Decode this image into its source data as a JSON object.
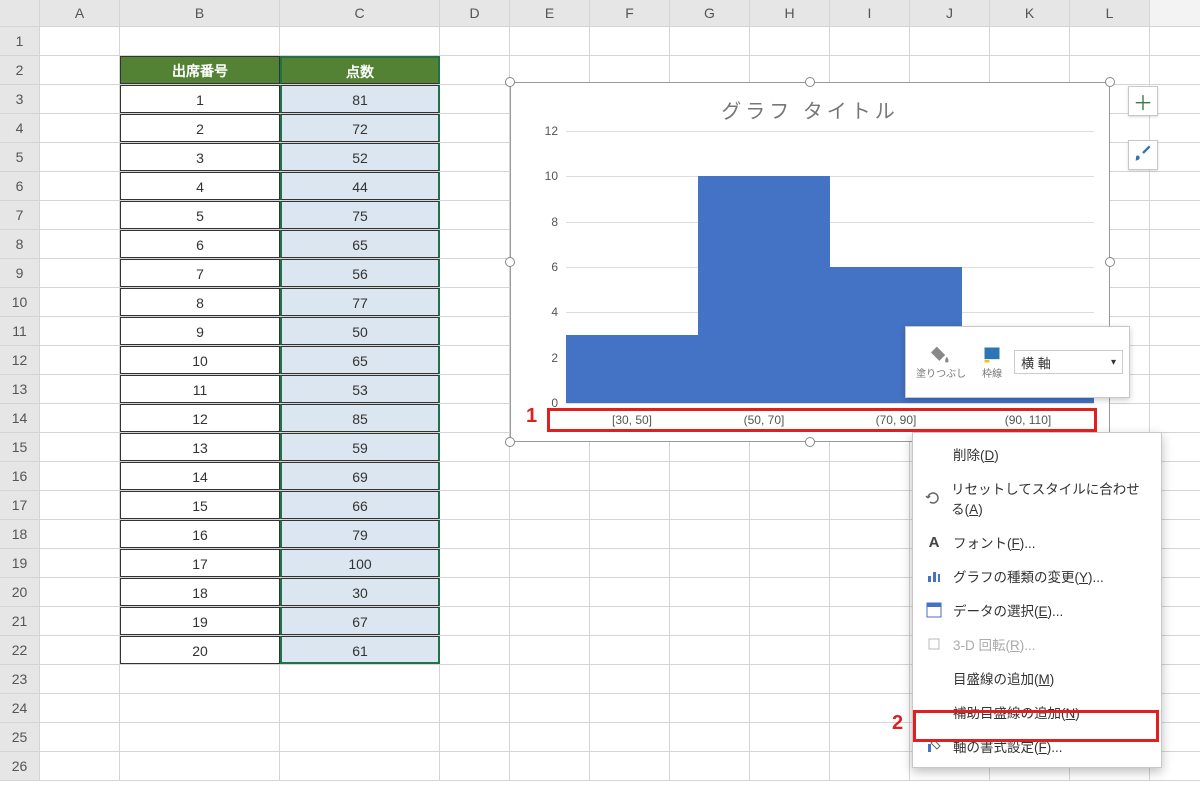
{
  "columns": [
    "A",
    "B",
    "C",
    "D",
    "E",
    "F",
    "G",
    "H",
    "I",
    "J",
    "K",
    "L"
  ],
  "row_count": 26,
  "table": {
    "header1": "出席番号",
    "header2": "点数",
    "rows": [
      {
        "n": "1",
        "v": "81"
      },
      {
        "n": "2",
        "v": "72"
      },
      {
        "n": "3",
        "v": "52"
      },
      {
        "n": "4",
        "v": "44"
      },
      {
        "n": "5",
        "v": "75"
      },
      {
        "n": "6",
        "v": "65"
      },
      {
        "n": "7",
        "v": "56"
      },
      {
        "n": "8",
        "v": "77"
      },
      {
        "n": "9",
        "v": "50"
      },
      {
        "n": "10",
        "v": "65"
      },
      {
        "n": "11",
        "v": "53"
      },
      {
        "n": "12",
        "v": "85"
      },
      {
        "n": "13",
        "v": "59"
      },
      {
        "n": "14",
        "v": "69"
      },
      {
        "n": "15",
        "v": "66"
      },
      {
        "n": "16",
        "v": "79"
      },
      {
        "n": "17",
        "v": "100"
      },
      {
        "n": "18",
        "v": "30"
      },
      {
        "n": "19",
        "v": "67"
      },
      {
        "n": "20",
        "v": "61"
      }
    ]
  },
  "chart_data": {
    "type": "bar",
    "title": "グラフ タイトル",
    "categories": [
      "[30, 50]",
      "(50, 70]",
      "(70, 90]",
      "(90, 110]"
    ],
    "values": [
      3,
      10,
      6,
      1
    ],
    "yticks": [
      "0",
      "2",
      "4",
      "6",
      "8",
      "10",
      "12"
    ],
    "ylim": [
      0,
      12
    ]
  },
  "mini_toolbar": {
    "fill_label": "塗りつぶし",
    "outline_label": "枠線",
    "selector": "横 軸"
  },
  "context_menu": {
    "items": [
      {
        "icon": "",
        "label": "削除(D)",
        "hotkey": "D"
      },
      {
        "icon": "reset",
        "label": "リセットしてスタイルに合わせる(A)",
        "hotkey": "A"
      },
      {
        "icon": "font",
        "label": "フォント(F)...",
        "hotkey": "F"
      },
      {
        "icon": "chart",
        "label": "グラフの種類の変更(Y)...",
        "hotkey": "Y"
      },
      {
        "icon": "data",
        "label": "データの選択(E)...",
        "hotkey": "E"
      },
      {
        "icon": "3d",
        "label": "3-D 回転(R)...",
        "hotkey": "R",
        "disabled": true
      },
      {
        "icon": "",
        "label": "目盛線の追加(M)",
        "hotkey": "M"
      },
      {
        "icon": "",
        "label": "補助目盛線の追加(N)",
        "hotkey": "N"
      },
      {
        "icon": "format",
        "label": "軸の書式設定(F)...",
        "hotkey": "F"
      }
    ]
  },
  "callouts": {
    "c1": "1",
    "c2": "2"
  }
}
